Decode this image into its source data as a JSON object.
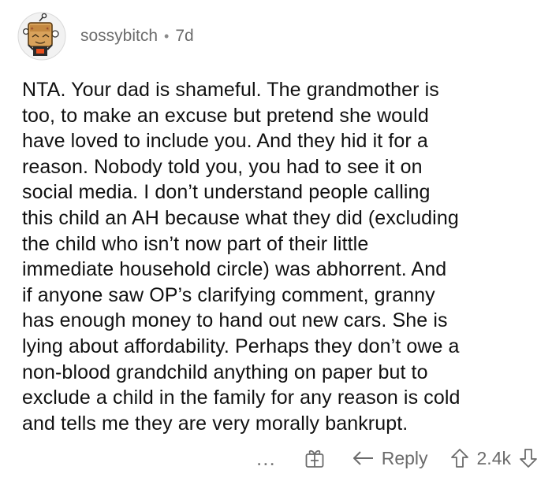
{
  "comment": {
    "username": "sossybitch",
    "separator": "•",
    "age": "7d",
    "body_lines": [
      "NTA. Your dad is shameful. The grandmother is",
      "too, to make an excuse but pretend she would",
      "have loved to include you. And they hid it for a",
      "reason. Nobody told you, you had to see it on",
      "social media. I don’t understand people calling",
      "this child an AH because what they did (excluding",
      "the child who isn’t now part of their little",
      "immediate household circle) was abhorrent. And",
      "if anyone saw OP’s clarifying comment, granny",
      "has enough money to hand out new cars. She is",
      "lying about affordability. Perhaps they don’t owe a",
      "non-blood grandchild anything on paper but to",
      "exclude a child in the family for any reason is cold",
      "and tells me they are very morally bankrupt."
    ]
  },
  "actions": {
    "more_label": "...",
    "reply_label": "Reply",
    "score": "2.4k"
  },
  "icons": {
    "avatar": "snoo-avatar-icon",
    "award": "award-gift-icon",
    "reply": "reply-arrow-icon",
    "upvote": "upvote-arrow-icon",
    "downvote": "downvote-arrow-icon"
  }
}
